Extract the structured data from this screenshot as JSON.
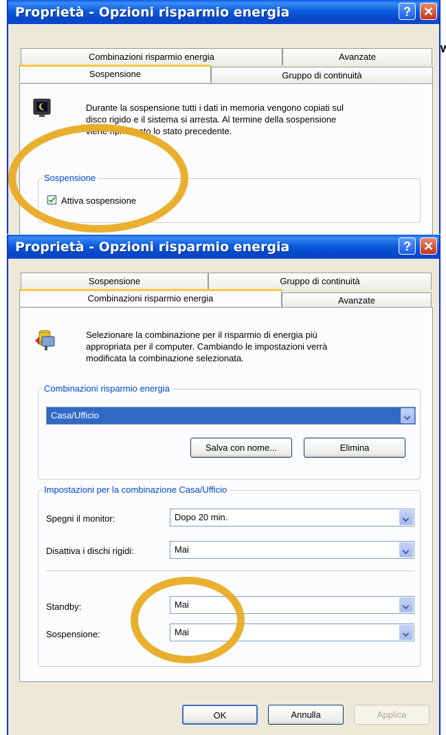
{
  "top_dialog": {
    "title": "Proprietà - Opzioni risparmio energia",
    "stray_char": "w",
    "tabs_row1": [
      "Combinazioni risparmio energia",
      "Avanzate"
    ],
    "tabs_row2": [
      "Sospensione",
      "Gruppo di continuità"
    ],
    "description": [
      "Durante la sospensione tutti i dati in memoria vengono copiati sul",
      "disco rigido e il sistema si arresta. Al termine della sospensione",
      "viene ripristinato lo stato precedente."
    ],
    "group_label": "Sospensione",
    "checkbox_label": "Attiva sospensione",
    "checkbox_checked": true
  },
  "bottom_dialog": {
    "title": "Proprietà - Opzioni risparmio energia",
    "tabs_row1": [
      "Sospensione",
      "Gruppo di continuità"
    ],
    "tabs_row2": [
      "Combinazioni risparmio energia",
      "Avanzate"
    ],
    "description": [
      "Selezionare la combinazione per il risparmio di energia più",
      "appropriata per il computer. Cambiando le impostazioni verrà",
      "modificata la combinazione selezionata."
    ],
    "schemes_group_label": "Combinazioni risparmio energia",
    "scheme_value": "Casa/Ufficio",
    "save_as_label": "Salva con nome...",
    "delete_label": "Elimina",
    "settings_group_label": "Impostazioni per la combinazione Casa/Ufficio",
    "settings": [
      {
        "label": "Spegni il monitor:",
        "value": "Dopo 20 min."
      },
      {
        "label": "Disattiva i dischi rigidi:",
        "value": "Mai"
      },
      {
        "label": "Standby:",
        "value": "Mai"
      },
      {
        "label": "Sospensione:",
        "value": "Mai"
      }
    ],
    "ok_label": "OK",
    "cancel_label": "Annulla",
    "apply_label": "Applica"
  },
  "colors": {
    "title_blue": "#0a5de6",
    "group_label": "#0046d5",
    "annotation_ring": "#e8ac25",
    "active_tab_accent": "#ffc83c"
  },
  "icons": {
    "hibernate": "hibernate-monitor-icon",
    "power": "power-scheme-icon",
    "help": "help-icon",
    "close": "close-icon"
  }
}
